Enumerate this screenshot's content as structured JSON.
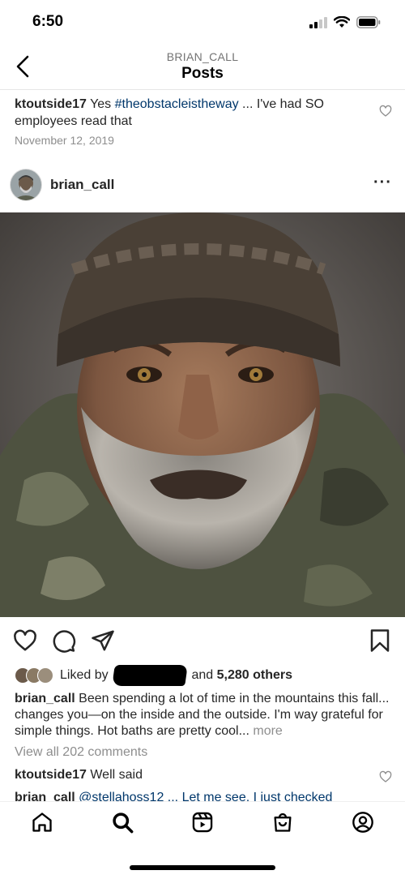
{
  "status_bar": {
    "time": "6:50"
  },
  "header": {
    "username_caps": "BRIAN_CALL",
    "title": "Posts"
  },
  "previous_comment": {
    "username": "ktoutside17",
    "text_before": " Yes ",
    "hashtag": "#theobstacleistheway",
    "text_after": " ... I've had SO employees read that",
    "date": "November 12, 2019"
  },
  "post": {
    "username": "brian_call",
    "more_icon": "···",
    "liked_by_prefix": "Liked by",
    "liked_by_suffix": "and",
    "liked_by_count": "5,280 others",
    "caption_username": "brian_call",
    "caption_text": " Been spending a lot of time in the mountains this fall... changes you—on the inside and the outside. I'm way grateful for simple things. Hot baths are pretty cool...",
    "more_label": " more",
    "view_all_comments": "View all 202 comments",
    "comment": {
      "username": "ktoutside17",
      "text": " Well said"
    },
    "cut_comment": {
      "username": "brian_call",
      "text": " @stellahoss12 ... Let me see, I just checked"
    }
  },
  "icons": {
    "back": "chevron-left-icon",
    "like": "heart-icon",
    "comment": "comment-icon",
    "share": "paper-plane-icon",
    "save": "bookmark-icon",
    "tabs": [
      "home-icon",
      "search-icon",
      "reels-icon",
      "shop-icon",
      "profile-icon"
    ]
  },
  "colors": {
    "hashtag": "#00376b",
    "secondary_text": "#8e8e8e",
    "text": "#262626"
  }
}
